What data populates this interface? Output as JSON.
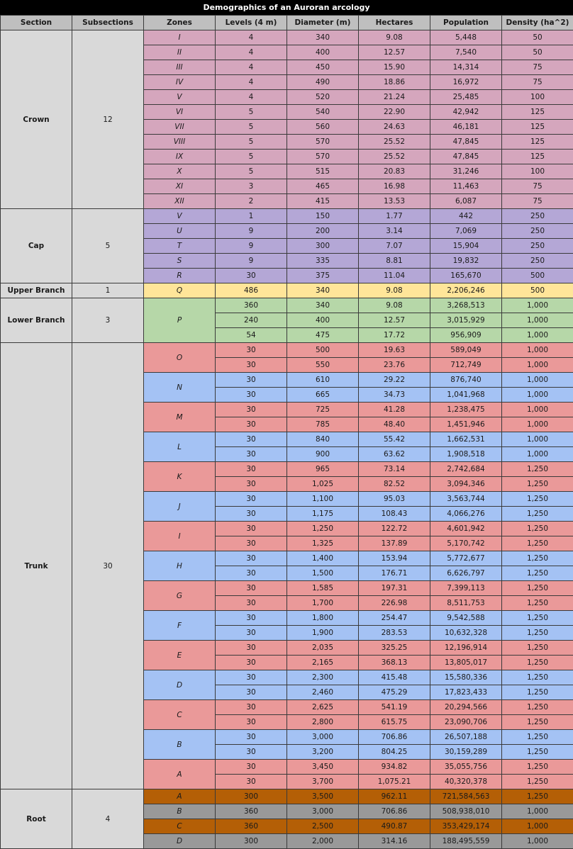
{
  "title": "Demographics of an Auroran arcology",
  "headers": [
    "Section",
    "Subsections",
    "Zones",
    "Levels (4 m)",
    "Diameter (m)",
    "Hectares",
    "Population",
    "Density (ha^2)"
  ],
  "colors": {
    "header": "#bfbfbf",
    "section": "#d9d9d9",
    "crown": "#d5a6bd",
    "cap": "#b4a7d6",
    "upper_branch": "#ffe599",
    "lower_branch": "#b6d7a8",
    "trunk_red": "#ea9999",
    "trunk_blue": "#a4c2f4",
    "root_orange": "#b45f06",
    "root_gray": "#999999"
  },
  "sections": [
    {
      "name": "Crown",
      "subsections": "12",
      "groups": [
        {
          "zone": "I",
          "color": "#d5a6bd",
          "rows": [
            [
              "4",
              "340",
              "9.08",
              "5,448",
              "50"
            ]
          ]
        },
        {
          "zone": "II",
          "color": "#d5a6bd",
          "rows": [
            [
              "4",
              "400",
              "12.57",
              "7,540",
              "50"
            ]
          ]
        },
        {
          "zone": "III",
          "color": "#d5a6bd",
          "rows": [
            [
              "4",
              "450",
              "15.90",
              "14,314",
              "75"
            ]
          ]
        },
        {
          "zone": "IV",
          "color": "#d5a6bd",
          "rows": [
            [
              "4",
              "490",
              "18.86",
              "16,972",
              "75"
            ]
          ]
        },
        {
          "zone": "V",
          "color": "#d5a6bd",
          "rows": [
            [
              "4",
              "520",
              "21.24",
              "25,485",
              "100"
            ]
          ]
        },
        {
          "zone": "VI",
          "color": "#d5a6bd",
          "rows": [
            [
              "5",
              "540",
              "22.90",
              "42,942",
              "125"
            ]
          ]
        },
        {
          "zone": "VII",
          "color": "#d5a6bd",
          "rows": [
            [
              "5",
              "560",
              "24.63",
              "46,181",
              "125"
            ]
          ]
        },
        {
          "zone": "VIII",
          "color": "#d5a6bd",
          "rows": [
            [
              "5",
              "570",
              "25.52",
              "47,845",
              "125"
            ]
          ]
        },
        {
          "zone": "IX",
          "color": "#d5a6bd",
          "rows": [
            [
              "5",
              "570",
              "25.52",
              "47,845",
              "125"
            ]
          ]
        },
        {
          "zone": "X",
          "color": "#d5a6bd",
          "rows": [
            [
              "5",
              "515",
              "20.83",
              "31,246",
              "100"
            ]
          ]
        },
        {
          "zone": "XI",
          "color": "#d5a6bd",
          "rows": [
            [
              "3",
              "465",
              "16.98",
              "11,463",
              "75"
            ]
          ]
        },
        {
          "zone": "XII",
          "color": "#d5a6bd",
          "rows": [
            [
              "2",
              "415",
              "13.53",
              "6,087",
              "75"
            ]
          ]
        }
      ]
    },
    {
      "name": "Cap",
      "subsections": "5",
      "groups": [
        {
          "zone": "V",
          "color": "#b4a7d6",
          "rows": [
            [
              "1",
              "150",
              "1.77",
              "442",
              "250"
            ]
          ]
        },
        {
          "zone": "U",
          "color": "#b4a7d6",
          "rows": [
            [
              "9",
              "200",
              "3.14",
              "7,069",
              "250"
            ]
          ]
        },
        {
          "zone": "T",
          "color": "#b4a7d6",
          "rows": [
            [
              "9",
              "300",
              "7.07",
              "15,904",
              "250"
            ]
          ]
        },
        {
          "zone": "S",
          "color": "#b4a7d6",
          "rows": [
            [
              "9",
              "335",
              "8.81",
              "19,832",
              "250"
            ]
          ]
        },
        {
          "zone": "R",
          "color": "#b4a7d6",
          "rows": [
            [
              "30",
              "375",
              "11.04",
              "165,670",
              "500"
            ]
          ]
        }
      ]
    },
    {
      "name": "Upper Branch",
      "subsections": "1",
      "groups": [
        {
          "zone": "Q",
          "color": "#ffe599",
          "rows": [
            [
              "486",
              "340",
              "9.08",
              "2,206,246",
              "500"
            ]
          ]
        }
      ]
    },
    {
      "name": "Lower Branch",
      "subsections": "3",
      "groups": [
        {
          "zone": "P",
          "color": "#b6d7a8",
          "rows": [
            [
              "360",
              "340",
              "9.08",
              "3,268,513",
              "1,000"
            ],
            [
              "240",
              "400",
              "12.57",
              "3,015,929",
              "1,000"
            ],
            [
              "54",
              "475",
              "17.72",
              "956,909",
              "1,000"
            ]
          ]
        }
      ]
    },
    {
      "name": "Trunk",
      "subsections": "30",
      "groups": [
        {
          "zone": "O",
          "color": "#ea9999",
          "rows": [
            [
              "30",
              "500",
              "19.63",
              "589,049",
              "1,000"
            ],
            [
              "30",
              "550",
              "23.76",
              "712,749",
              "1,000"
            ]
          ]
        },
        {
          "zone": "N",
          "color": "#a4c2f4",
          "rows": [
            [
              "30",
              "610",
              "29.22",
              "876,740",
              "1,000"
            ],
            [
              "30",
              "665",
              "34.73",
              "1,041,968",
              "1,000"
            ]
          ]
        },
        {
          "zone": "M",
          "color": "#ea9999",
          "rows": [
            [
              "30",
              "725",
              "41.28",
              "1,238,475",
              "1,000"
            ],
            [
              "30",
              "785",
              "48.40",
              "1,451,946",
              "1,000"
            ]
          ]
        },
        {
          "zone": "L",
          "color": "#a4c2f4",
          "rows": [
            [
              "30",
              "840",
              "55.42",
              "1,662,531",
              "1,000"
            ],
            [
              "30",
              "900",
              "63.62",
              "1,908,518",
              "1,000"
            ]
          ]
        },
        {
          "zone": "K",
          "color": "#ea9999",
          "rows": [
            [
              "30",
              "965",
              "73.14",
              "2,742,684",
              "1,250"
            ],
            [
              "30",
              "1,025",
              "82.52",
              "3,094,346",
              "1,250"
            ]
          ]
        },
        {
          "zone": "J",
          "color": "#a4c2f4",
          "rows": [
            [
              "30",
              "1,100",
              "95.03",
              "3,563,744",
              "1,250"
            ],
            [
              "30",
              "1,175",
              "108.43",
              "4,066,276",
              "1,250"
            ]
          ]
        },
        {
          "zone": "I",
          "color": "#ea9999",
          "rows": [
            [
              "30",
              "1,250",
              "122.72",
              "4,601,942",
              "1,250"
            ],
            [
              "30",
              "1,325",
              "137.89",
              "5,170,742",
              "1,250"
            ]
          ]
        },
        {
          "zone": "H",
          "color": "#a4c2f4",
          "rows": [
            [
              "30",
              "1,400",
              "153.94",
              "5,772,677",
              "1,250"
            ],
            [
              "30",
              "1,500",
              "176.71",
              "6,626,797",
              "1,250"
            ]
          ]
        },
        {
          "zone": "G",
          "color": "#ea9999",
          "rows": [
            [
              "30",
              "1,585",
              "197.31",
              "7,399,113",
              "1,250"
            ],
            [
              "30",
              "1,700",
              "226.98",
              "8,511,753",
              "1,250"
            ]
          ]
        },
        {
          "zone": "F",
          "color": "#a4c2f4",
          "rows": [
            [
              "30",
              "1,800",
              "254.47",
              "9,542,588",
              "1,250"
            ],
            [
              "30",
              "1,900",
              "283.53",
              "10,632,328",
              "1,250"
            ]
          ]
        },
        {
          "zone": "E",
          "color": "#ea9999",
          "rows": [
            [
              "30",
              "2,035",
              "325.25",
              "12,196,914",
              "1,250"
            ],
            [
              "30",
              "2,165",
              "368.13",
              "13,805,017",
              "1,250"
            ]
          ]
        },
        {
          "zone": "D",
          "color": "#a4c2f4",
          "rows": [
            [
              "30",
              "2,300",
              "415.48",
              "15,580,336",
              "1,250"
            ],
            [
              "30",
              "2,460",
              "475.29",
              "17,823,433",
              "1,250"
            ]
          ]
        },
        {
          "zone": "C",
          "color": "#ea9999",
          "rows": [
            [
              "30",
              "2,625",
              "541.19",
              "20,294,566",
              "1,250"
            ],
            [
              "30",
              "2,800",
              "615.75",
              "23,090,706",
              "1,250"
            ]
          ]
        },
        {
          "zone": "B",
          "color": "#a4c2f4",
          "rows": [
            [
              "30",
              "3,000",
              "706.86",
              "26,507,188",
              "1,250"
            ],
            [
              "30",
              "3,200",
              "804.25",
              "30,159,289",
              "1,250"
            ]
          ]
        },
        {
          "zone": "A",
          "color": "#ea9999",
          "rows": [
            [
              "30",
              "3,450",
              "934.82",
              "35,055,756",
              "1,250"
            ],
            [
              "30",
              "3,700",
              "1,075.21",
              "40,320,378",
              "1,250"
            ]
          ]
        }
      ]
    },
    {
      "name": "Root",
      "subsections": "4",
      "groups": [
        {
          "zone": "A",
          "color": "#b45f06",
          "rows": [
            [
              "300",
              "3,500",
              "962.11",
              "721,584,563",
              "1,250"
            ]
          ]
        },
        {
          "zone": "B",
          "color": "#999999",
          "rows": [
            [
              "360",
              "3,000",
              "706.86",
              "508,938,010",
              "1,000"
            ]
          ]
        },
        {
          "zone": "C",
          "color": "#b45f06",
          "rows": [
            [
              "360",
              "2,500",
              "490.87",
              "353,429,174",
              "1,000"
            ]
          ]
        },
        {
          "zone": "D",
          "color": "#999999",
          "rows": [
            [
              "300",
              "2,000",
              "314.16",
              "188,495,559",
              "1,000"
            ]
          ]
        }
      ]
    }
  ]
}
